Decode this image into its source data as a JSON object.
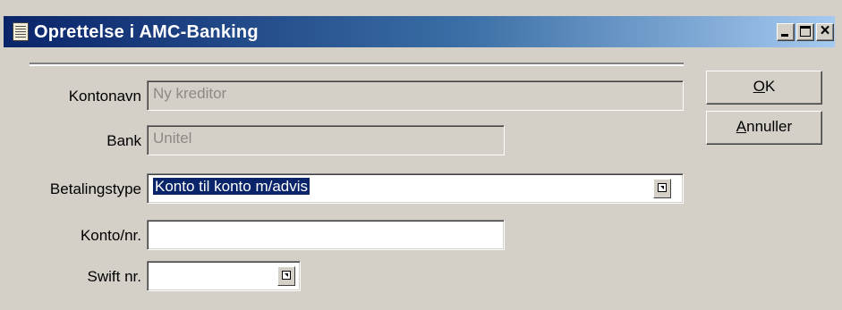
{
  "window": {
    "title": "Oprettelse i AMC-Banking",
    "icon": "form-icon"
  },
  "titlebar_buttons": {
    "minimize": "minimize-icon",
    "maximize": "maximize-icon",
    "close": "close-icon"
  },
  "form": {
    "kontonavn": {
      "label": "Kontonavn",
      "value": "Ny kreditor"
    },
    "bank": {
      "label": "Bank",
      "value": "Unitel"
    },
    "betalingstype": {
      "label": "Betalingstype",
      "value": "Konto til konto m/advis"
    },
    "konto_nr": {
      "label": "Konto/nr.",
      "value": ""
    },
    "swift_nr": {
      "label": "Swift nr.",
      "value": ""
    }
  },
  "buttons": {
    "ok": {
      "mnemonic": "O",
      "rest": "K"
    },
    "cancel": {
      "mnemonic": "A",
      "rest": "nnuller"
    }
  },
  "colors": {
    "titlebar_start": "#0a246a",
    "titlebar_end": "#a6caf0",
    "dialog_bg": "#d4d0c8",
    "selection": "#0a246a"
  }
}
